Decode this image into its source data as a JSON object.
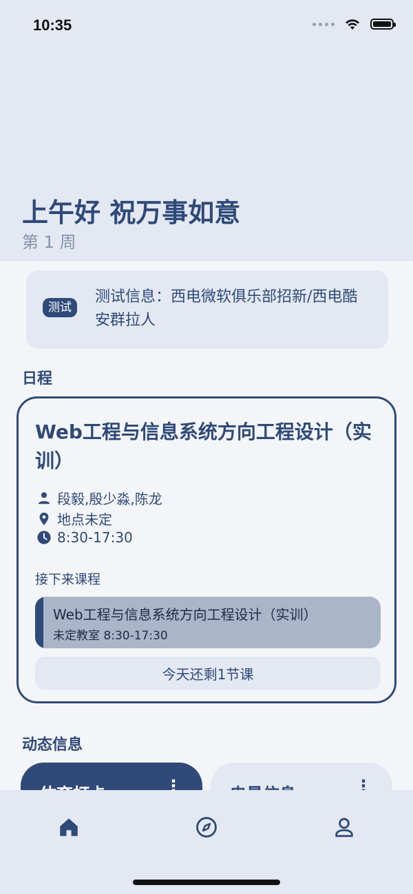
{
  "status_bar": {
    "time": "10:35"
  },
  "header": {
    "greeting": "上午好 祝万事如意",
    "week": "第 1 周"
  },
  "notice": {
    "tag": "测试",
    "text": "测试信息：西电微软俱乐部招新/西电酷安群拉人"
  },
  "schedule": {
    "section_title": "日程",
    "course_title": "Web工程与信息系统方向工程设计（实训）",
    "teachers": "段毅,殷少淼,陈龙",
    "location": "地点未定",
    "time": "8:30-17:30",
    "next_label": "接下来课程",
    "next_course": {
      "name": "Web工程与信息系统方向工程设计（实训）",
      "detail": "未定教室 8:30-17:30"
    },
    "remaining": "今天还剩1节课"
  },
  "dynamic": {
    "section_title": "动态信息",
    "cards": [
      {
        "title": "体育打卡",
        "more": "⋮"
      },
      {
        "title": "电量信息",
        "more": "⋮"
      }
    ]
  },
  "tab_bar": {
    "items": [
      {
        "icon": "home-icon"
      },
      {
        "icon": "compass-icon"
      },
      {
        "icon": "person-icon"
      }
    ]
  },
  "colors": {
    "primary": "#2f4a78",
    "surface": "#e3e8f3",
    "background": "#f4f5f9"
  }
}
